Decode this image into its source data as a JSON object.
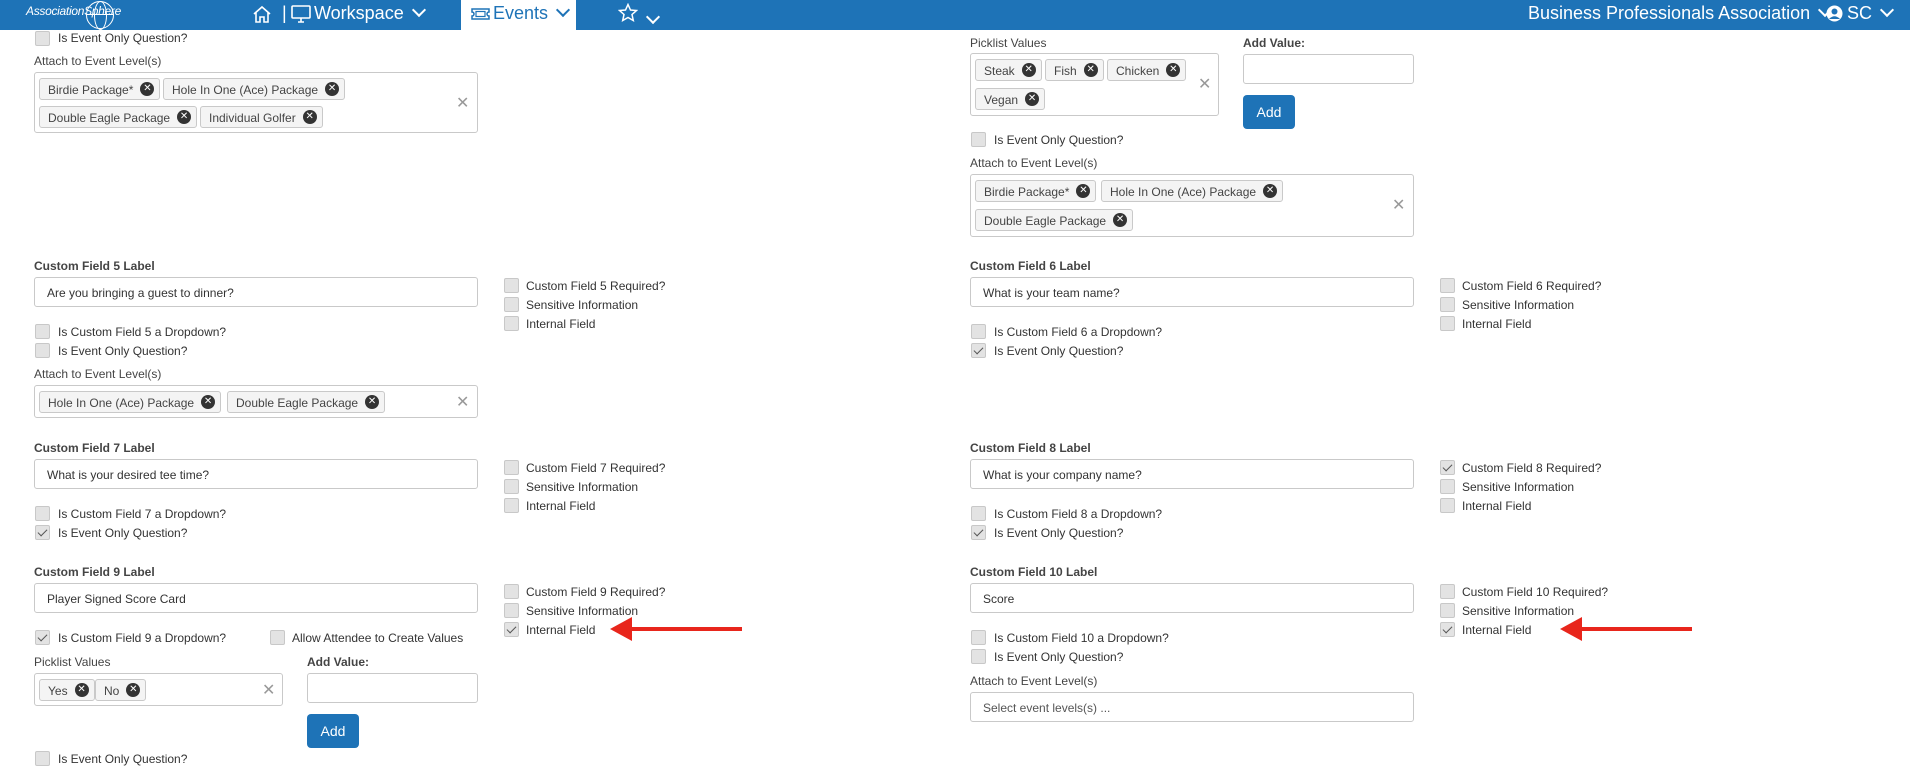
{
  "nav": {
    "logo_text": "AssociationSphere",
    "workspace_label": "Workspace",
    "events_label": "Events",
    "org_name": "Business Professionals Association",
    "user_initials": "SC"
  },
  "colors": {
    "brand": "#1e73b7",
    "annotation_arrow": "#e8261c"
  },
  "left_top": {
    "event_only_label": "Is Event Only Question?",
    "attach_label": "Attach to Event Level(s)",
    "levels": [
      "Birdie Package*",
      "Hole In One (Ace) Package",
      "Double Eagle Package",
      "Individual Golfer"
    ]
  },
  "right_top": {
    "picklist_label": "Picklist Values",
    "picklist_values": [
      "Steak",
      "Fish",
      "Chicken",
      "Vegan"
    ],
    "add_value_label": "Add Value:",
    "add_button": "Add",
    "event_only_label": "Is Event Only Question?",
    "attach_label": "Attach to Event Level(s)",
    "levels": [
      "Birdie Package*",
      "Hole In One (Ace) Package",
      "Double Eagle Package"
    ]
  },
  "cf5": {
    "label": "Custom Field 5 Label",
    "value": "Are you bringing a guest to dinner?",
    "required": "Custom Field 5 Required?",
    "sensitive": "Sensitive Information",
    "internal": "Internal Field",
    "dropdown": "Is Custom Field 5 a Dropdown?",
    "event_only": "Is Event Only Question?",
    "attach_label": "Attach to Event Level(s)",
    "levels": [
      "Hole In One (Ace) Package",
      "Double Eagle Package"
    ]
  },
  "cf6": {
    "label": "Custom Field 6 Label",
    "value": "What is your team name?",
    "required": "Custom Field 6 Required?",
    "sensitive": "Sensitive Information",
    "internal": "Internal Field",
    "dropdown": "Is Custom Field 6 a Dropdown?",
    "event_only": "Is Event Only Question?"
  },
  "cf7": {
    "label": "Custom Field 7 Label",
    "value": "What is your desired tee time?",
    "required": "Custom Field 7 Required?",
    "sensitive": "Sensitive Information",
    "internal": "Internal Field",
    "dropdown": "Is Custom Field 7 a Dropdown?",
    "event_only": "Is Event Only Question?"
  },
  "cf8": {
    "label": "Custom Field 8 Label",
    "value": "What is your company name?",
    "required": "Custom Field 8 Required?",
    "sensitive": "Sensitive Information",
    "internal": "Internal Field",
    "dropdown": "Is Custom Field 8 a Dropdown?",
    "event_only": "Is Event Only Question?"
  },
  "cf9": {
    "label": "Custom Field 9 Label",
    "value": "Player Signed Score Card",
    "required": "Custom Field 9 Required?",
    "sensitive": "Sensitive Information",
    "internal": "Internal Field",
    "dropdown": "Is Custom Field 9 a Dropdown?",
    "allow_create": "Allow Attendee to Create Values",
    "picklist_label": "Picklist Values",
    "picklist_values": [
      "Yes",
      "No"
    ],
    "add_value_label": "Add Value:",
    "add_button": "Add",
    "event_only": "Is Event Only Question?"
  },
  "cf10": {
    "label": "Custom Field 10 Label",
    "value": "Score",
    "required": "Custom Field 10 Required?",
    "sensitive": "Sensitive Information",
    "internal": "Internal Field",
    "dropdown": "Is Custom Field 10 a Dropdown?",
    "event_only": "Is Event Only Question?",
    "attach_label": "Attach to Event Level(s)",
    "attach_placeholder": "Select event levels(s) ..."
  }
}
